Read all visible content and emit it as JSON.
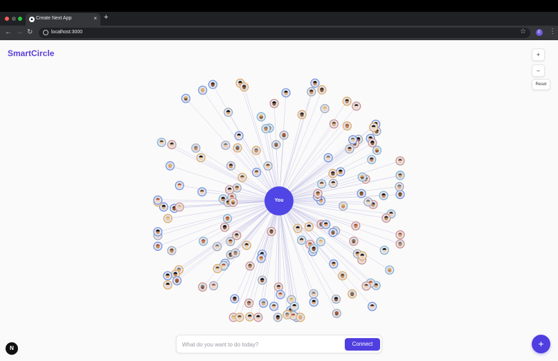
{
  "browser": {
    "tab_title": "Create Next App",
    "tab_close": "×",
    "new_tab": "+",
    "url": "localhost:3000",
    "profile_initial": "E",
    "back_glyph": "←",
    "forward_glyph": "→",
    "reload_glyph": "↻",
    "star_glyph": "☆",
    "menu_glyph": "⋮",
    "favicon_glyph": "▲"
  },
  "app": {
    "brand": "SmartCircle",
    "zoom_in": "+",
    "zoom_out": "−",
    "reset": "Reset",
    "center_label": "You",
    "prompt_placeholder": "What do you want to do today?",
    "connect": "Connect",
    "fab": "+",
    "next_logo": "N"
  },
  "colors": {
    "brand": "#5b3fd8",
    "center_node": "#4f46e5",
    "edge": "#c9c6e8",
    "node_rings": [
      "#6f8fe0",
      "#a0a6b8",
      "#d08a86",
      "#e0a85c",
      "#7fb0d0"
    ]
  },
  "graph": {
    "contact_count": 160
  }
}
